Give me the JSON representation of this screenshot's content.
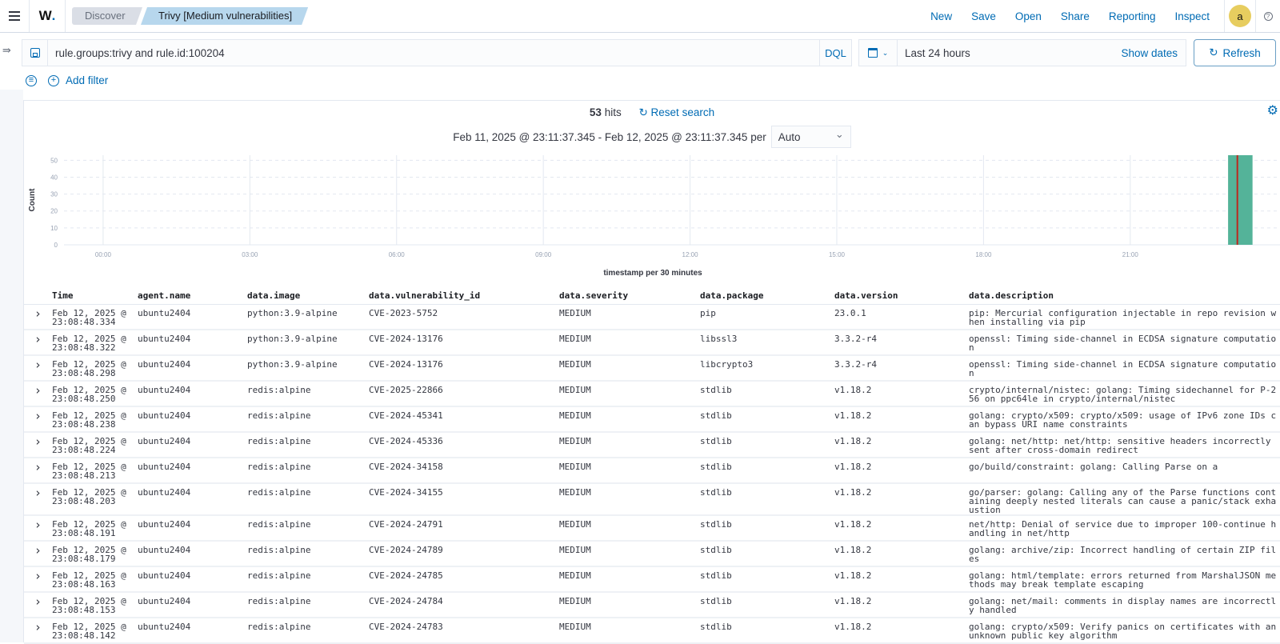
{
  "header": {
    "menu_icon": "hamburger-icon",
    "logo": {
      "text": "W",
      "dot": "."
    },
    "breadcrumbs": [
      "Discover",
      "Trivy [Medium vulnerabilities]"
    ],
    "links": [
      "New",
      "Save",
      "Open",
      "Share",
      "Reporting",
      "Inspect"
    ],
    "avatar_initial": "a",
    "help_icon": "?"
  },
  "query": {
    "value": "rule.groups:trivy and rule.id:100204",
    "language": "DQL",
    "time_range": "Last 24 hours",
    "show_dates": "Show dates",
    "refresh": "Refresh"
  },
  "filters": {
    "add_filter": "Add filter"
  },
  "summary": {
    "hits_count": "53",
    "hits_label": "hits",
    "reset_search": "Reset search",
    "range_text": "Feb 11, 2025 @ 23:11:37.345 - Feb 12, 2025 @ 23:11:37.345 per",
    "interval": "Auto"
  },
  "chart_data": {
    "type": "bar",
    "title": "",
    "xlabel": "timestamp per 30 minutes",
    "ylabel": "Count",
    "ylim": [
      0,
      53
    ],
    "yticks": [
      0,
      10,
      20,
      30,
      40,
      50
    ],
    "xticks": [
      "00:00",
      "03:00",
      "06:00",
      "09:00",
      "12:00",
      "15:00",
      "18:00",
      "21:00"
    ],
    "x_range_hours": [
      -0.8,
      23.8
    ],
    "grid": true,
    "bar_color": "#54b399",
    "now_marker_color": "#bd271e",
    "bars": [
      {
        "start_hour": 23.0,
        "end_hour": 23.5,
        "value": 53
      }
    ],
    "now_marker_hour": 23.19
  },
  "table": {
    "columns": [
      "Time",
      "agent.name",
      "data.image",
      "data.vulnerability_id",
      "data.severity",
      "data.package",
      "data.version",
      "data.description"
    ],
    "rows": [
      [
        "Feb 12, 2025 @\n23:08:48.334",
        "ubuntu2404",
        "python:3.9-alpine",
        "CVE-2023-5752",
        "MEDIUM",
        "pip",
        "23.0.1",
        "pip: Mercurial configuration injectable in repo revision when installing via pip"
      ],
      [
        "Feb 12, 2025 @\n23:08:48.322",
        "ubuntu2404",
        "python:3.9-alpine",
        "CVE-2024-13176",
        "MEDIUM",
        "libssl3",
        "3.3.2-r4",
        "openssl: Timing side-channel in ECDSA signature computation"
      ],
      [
        "Feb 12, 2025 @\n23:08:48.298",
        "ubuntu2404",
        "python:3.9-alpine",
        "CVE-2024-13176",
        "MEDIUM",
        "libcrypto3",
        "3.3.2-r4",
        "openssl: Timing side-channel in ECDSA signature computation"
      ],
      [
        "Feb 12, 2025 @\n23:08:48.250",
        "ubuntu2404",
        "redis:alpine",
        "CVE-2025-22866",
        "MEDIUM",
        "stdlib",
        "v1.18.2",
        "crypto/internal/nistec: golang: Timing sidechannel for P-256 on ppc64le in crypto/internal/nistec"
      ],
      [
        "Feb 12, 2025 @\n23:08:48.238",
        "ubuntu2404",
        "redis:alpine",
        "CVE-2024-45341",
        "MEDIUM",
        "stdlib",
        "v1.18.2",
        "golang: crypto/x509: crypto/x509: usage of IPv6 zone IDs can bypass URI name constraints"
      ],
      [
        "Feb 12, 2025 @\n23:08:48.224",
        "ubuntu2404",
        "redis:alpine",
        "CVE-2024-45336",
        "MEDIUM",
        "stdlib",
        "v1.18.2",
        "golang: net/http: net/http: sensitive headers incorrectly sent after cross-domain redirect"
      ],
      [
        "Feb 12, 2025 @\n23:08:48.213",
        "ubuntu2404",
        "redis:alpine",
        "CVE-2024-34158",
        "MEDIUM",
        "stdlib",
        "v1.18.2",
        "go/build/constraint: golang: Calling Parse on a"
      ],
      [
        "Feb 12, 2025 @\n23:08:48.203",
        "ubuntu2404",
        "redis:alpine",
        "CVE-2024-34155",
        "MEDIUM",
        "stdlib",
        "v1.18.2",
        "go/parser: golang: Calling any of the Parse functions containing deeply nested literals can cause a panic/stack exhaustion"
      ],
      [
        "Feb 12, 2025 @\n23:08:48.191",
        "ubuntu2404",
        "redis:alpine",
        "CVE-2024-24791",
        "MEDIUM",
        "stdlib",
        "v1.18.2",
        "net/http: Denial of service due to improper 100-continue handling in net/http"
      ],
      [
        "Feb 12, 2025 @\n23:08:48.179",
        "ubuntu2404",
        "redis:alpine",
        "CVE-2024-24789",
        "MEDIUM",
        "stdlib",
        "v1.18.2",
        "golang: archive/zip: Incorrect handling of certain ZIP files"
      ],
      [
        "Feb 12, 2025 @\n23:08:48.163",
        "ubuntu2404",
        "redis:alpine",
        "CVE-2024-24785",
        "MEDIUM",
        "stdlib",
        "v1.18.2",
        "golang: html/template: errors returned from MarshalJSON methods may break template escaping"
      ],
      [
        "Feb 12, 2025 @\n23:08:48.153",
        "ubuntu2404",
        "redis:alpine",
        "CVE-2024-24784",
        "MEDIUM",
        "stdlib",
        "v1.18.2",
        "golang: net/mail: comments in display names are incorrectly handled"
      ],
      [
        "Feb 12, 2025 @\n23:08:48.142",
        "ubuntu2404",
        "redis:alpine",
        "CVE-2024-24783",
        "MEDIUM",
        "stdlib",
        "v1.18.2",
        "golang: crypto/x509: Verify panics on certificates with an unknown public key algorithm"
      ]
    ]
  }
}
